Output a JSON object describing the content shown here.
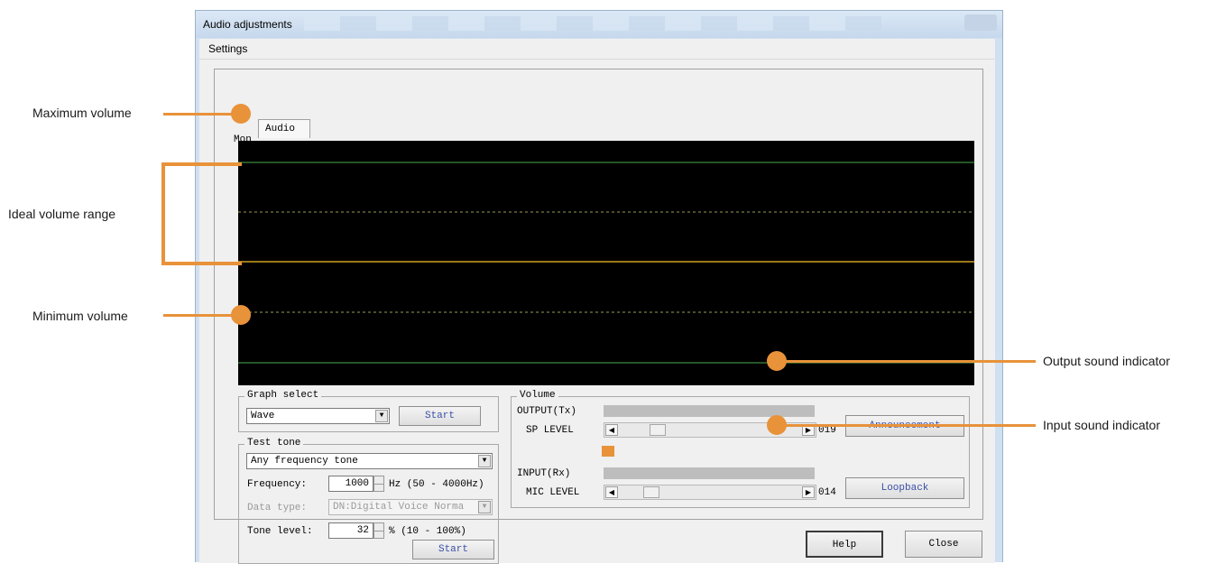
{
  "window": {
    "title": "Audio adjustments"
  },
  "menu": {
    "settings": "Settings"
  },
  "tabs": {
    "monitor": "Mon",
    "audio": "Audio"
  },
  "graph_select": {
    "title": "Graph select",
    "value": "Wave",
    "start": "Start"
  },
  "test_tone": {
    "title": "Test tone",
    "mode": "Any frequency tone",
    "frequency_label": "Frequency:",
    "frequency_value": "1000",
    "frequency_range": "Hz (50 - 4000Hz)",
    "data_type_label": "Data type:",
    "data_type_value": "DN:Digital Voice Norma",
    "tone_level_label": "Tone level:",
    "tone_level_value": "32",
    "tone_level_range": "% (10 - 100%)",
    "start": "Start"
  },
  "volume": {
    "title": "Volume",
    "output_label": "OUTPUT(Tx)",
    "sp_level_label": "SP LEVEL",
    "sp_level_value": "019",
    "announcement": "Announcement",
    "input_label": "INPUT(Rx)",
    "mic_level_label": "MIC LEVEL",
    "mic_level_value": "014",
    "loopback": "Loopback"
  },
  "footer": {
    "help": "Help",
    "close": "Close"
  },
  "annotations": {
    "max": "Maximum volume",
    "ideal": "Ideal volume range",
    "min": "Minimum volume",
    "output": "Output sound indicator",
    "input": "Input sound indicator"
  },
  "colors": {
    "accent": "#e8923a",
    "graph_bg": "#000000",
    "max_min_line": "#3e8a3e",
    "ideal_line": "#9a9a5a",
    "wave_line": "#d0a020"
  }
}
